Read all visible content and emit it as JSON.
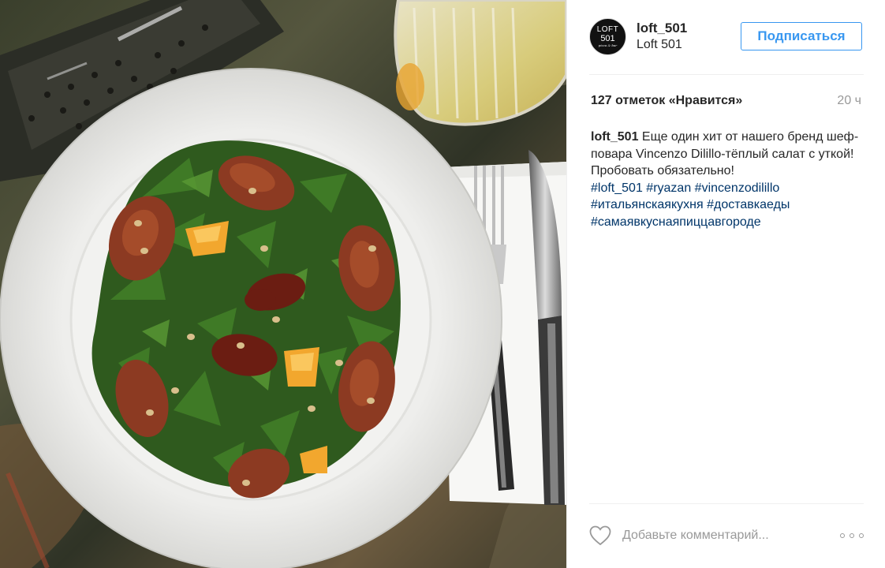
{
  "account": {
    "username": "loft_501",
    "full_name": "Loft 501",
    "avatar_line1": "LOFT",
    "avatar_line2": "501",
    "avatar_line3": "pizza & bar"
  },
  "follow_button": {
    "label": "Подписаться"
  },
  "post": {
    "likes": "127 отметок «Нравится»",
    "time": "20 ч",
    "caption_user": "loft_501",
    "caption_text": " Еще один хит от нашего бренд шеф-повара Vincenzo Dilillo-тёплый салат с уткой! Пробовать обязательно!",
    "hashtags": [
      "#loft_501",
      "#ryazan",
      "#vincenzodilillo",
      "#итальянскаякухня",
      "#доставкаеды",
      "#самаявкуснаяпиццавгороде"
    ]
  },
  "comment": {
    "placeholder": "Добавьте комментарий..."
  },
  "icons": {
    "like": "heart-icon",
    "more": "more-options-icon"
  },
  "colors": {
    "accent": "#3897f0",
    "hashtag": "#003569",
    "muted": "#999999",
    "text": "#262626"
  }
}
